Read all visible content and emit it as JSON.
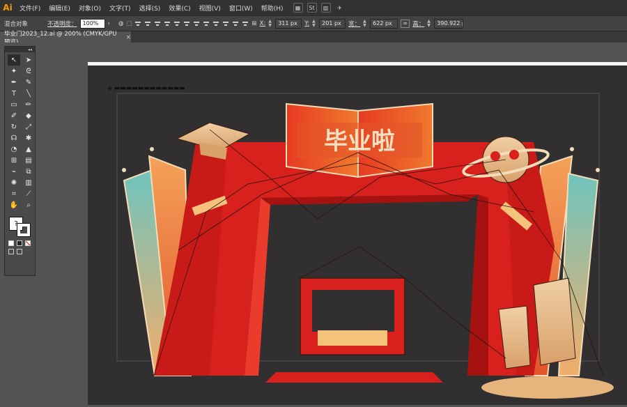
{
  "app": {
    "logo": "Ai"
  },
  "menu": [
    {
      "label": "文件(F)"
    },
    {
      "label": "编辑(E)"
    },
    {
      "label": "对象(O)"
    },
    {
      "label": "文字(T)"
    },
    {
      "label": "选择(S)"
    },
    {
      "label": "效果(C)"
    },
    {
      "label": "视图(V)"
    },
    {
      "label": "窗口(W)"
    },
    {
      "label": "帮助(H)"
    }
  ],
  "menu_icons": [
    {
      "icon": "bridge-icon"
    },
    {
      "icon": "stock-icon"
    },
    {
      "icon": "workspace-icon"
    },
    {
      "icon": "gpu-performance-icon"
    }
  ],
  "control": {
    "selection_label": "混合对象",
    "opacity_label": "不透明度：",
    "opacity_value": "100%",
    "x_label": "X:",
    "x_value": "311 px",
    "y_label": "Y:",
    "y_value": "201 px",
    "w_label": "宽：",
    "w_value": "622 px",
    "h_label": "高：",
    "h_value": "390.922 px"
  },
  "tab": {
    "title": "毕业门2023_12.ai @ 200% (CMYK/GPU 预览)",
    "close": "×"
  },
  "tools_header": "◂◂",
  "artwork": {
    "headline": "毕业啦",
    "colors": {
      "red_main": "#d8201c",
      "red_dark": "#a5120f",
      "red_light": "#ea3b2c",
      "orange": "#ef7d2b",
      "gold": "#e6b57d",
      "teal": "#5fb9b5",
      "dark_bg": "#322f30"
    }
  }
}
